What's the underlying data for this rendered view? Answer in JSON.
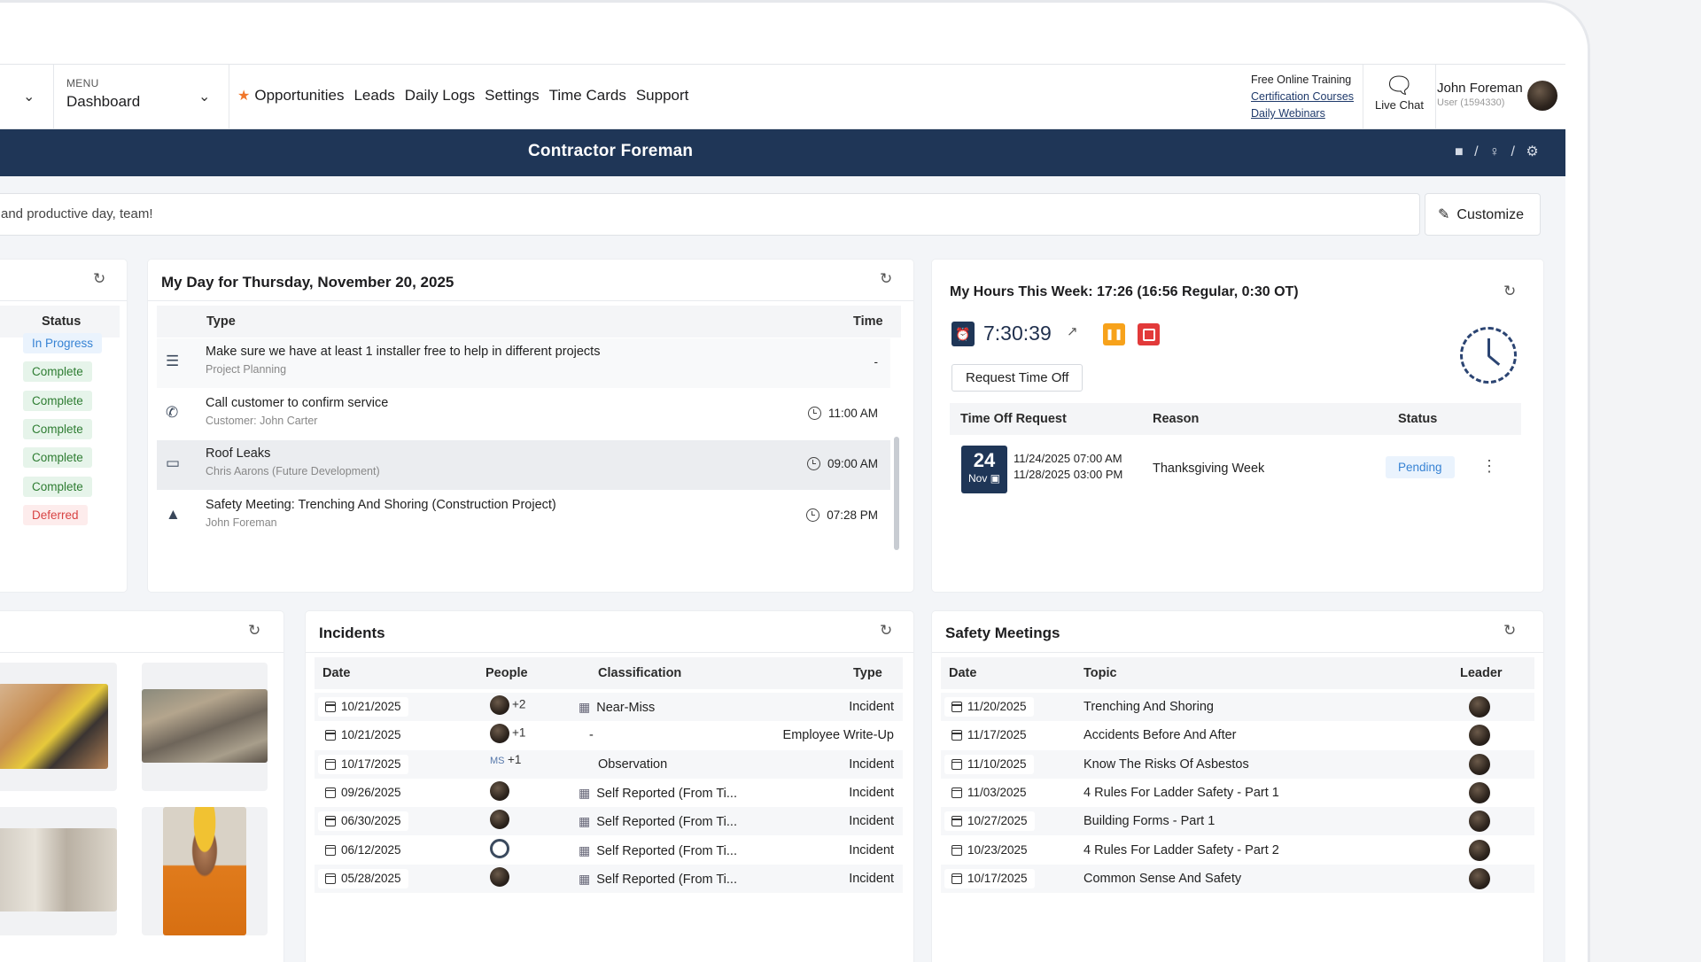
{
  "nav": {
    "menu_caption": "MENU",
    "menu_value": "Dashboard",
    "links": [
      "Opportunities",
      "Leads",
      "Daily Logs",
      "Settings",
      "Time Cards",
      "Support"
    ],
    "training_title": "Free Online Training",
    "training_links": [
      "Certification Courses",
      "Daily Webinars"
    ],
    "live_chat": "Live Chat",
    "user_name": "John Foreman",
    "user_sub": "User (1594330)"
  },
  "banner": {
    "title": "Contractor Foreman",
    "tools": "■ / ♀ / ⚙"
  },
  "message": "and productive day, team!",
  "customize": "Customize",
  "status_card": {
    "header": "Status",
    "items": [
      {
        "label": "In Progress",
        "kind": "blue"
      },
      {
        "label": "Complete",
        "kind": "green"
      },
      {
        "label": "Complete",
        "kind": "green"
      },
      {
        "label": "Complete",
        "kind": "green"
      },
      {
        "label": "Complete",
        "kind": "green"
      },
      {
        "label": "Complete",
        "kind": "green"
      },
      {
        "label": "Deferred",
        "kind": "red"
      }
    ]
  },
  "my_day": {
    "title": "My Day for Thursday, November 20, 2025",
    "col_type": "Type",
    "col_time": "Time",
    "rows": [
      {
        "icon": "list-icon",
        "glyph": "☰",
        "title": "Make sure we have at least 1 installer free to help in different projects",
        "sub": "Project Planning",
        "time": "-",
        "clock": false
      },
      {
        "icon": "phone-icon",
        "glyph": "✆",
        "title": "Call customer to confirm service",
        "sub": "Customer: John Carter",
        "time": "11:00 AM",
        "clock": true
      },
      {
        "icon": "ticket-icon",
        "glyph": "▭",
        "title": "Roof Leaks",
        "sub": "Chris Aarons (Future Development)",
        "time": "09:00 AM",
        "clock": true
      },
      {
        "icon": "person-icon",
        "glyph": "▲",
        "title": "Safety Meeting: Trenching And Shoring (Construction Project)",
        "sub": "John Foreman",
        "time": "07:28 PM",
        "clock": true
      }
    ]
  },
  "hours": {
    "title": "My Hours This Week: 17:26 (16:56 Regular, 0:30 OT)",
    "timer": "7:30:39",
    "request_btn": "Request Time Off",
    "col_request": "Time Off Request",
    "col_reason": "Reason",
    "col_status": "Status",
    "request": {
      "day": "24",
      "month": "Nov",
      "start": "11/24/2025 07:00 AM",
      "end": "11/28/2025 03:00 PM",
      "reason": "Thanksgiving Week",
      "status": "Pending"
    }
  },
  "incidents": {
    "title": "Incidents",
    "cols": [
      "Date",
      "People",
      "Classification",
      "Type"
    ],
    "rows": [
      {
        "date": "10/21/2025",
        "people": "+2",
        "people_kind": "avatar",
        "classification": "Near-Miss",
        "class_icon": true,
        "type": "Incident"
      },
      {
        "date": "10/21/2025",
        "people": "+1",
        "people_kind": "avatar",
        "classification": "-",
        "class_icon": false,
        "type": "Employee Write-Up"
      },
      {
        "date": "10/17/2025",
        "people": "+1",
        "people_kind": "ms",
        "classification": "Observation",
        "class_icon": false,
        "type": "Incident"
      },
      {
        "date": "09/26/2025",
        "people": "",
        "people_kind": "avatar",
        "classification": "Self Reported (From Ti...",
        "class_icon": true,
        "type": "Incident"
      },
      {
        "date": "06/30/2025",
        "people": "",
        "people_kind": "avatar",
        "classification": "Self Reported (From Ti...",
        "class_icon": true,
        "type": "Incident"
      },
      {
        "date": "06/12/2025",
        "people": "",
        "people_kind": "ghost",
        "classification": "Self Reported (From Ti...",
        "class_icon": true,
        "type": "Incident"
      },
      {
        "date": "05/28/2025",
        "people": "",
        "people_kind": "avatar",
        "classification": "Self Reported (From Ti...",
        "class_icon": true,
        "type": "Incident"
      }
    ],
    "ms_initials": "MS"
  },
  "safety": {
    "title": "Safety Meetings",
    "cols": [
      "Date",
      "Topic",
      "Leader"
    ],
    "rows": [
      {
        "date": "11/20/2025",
        "topic": "Trenching And Shoring"
      },
      {
        "date": "11/17/2025",
        "topic": "Accidents Before And After"
      },
      {
        "date": "11/10/2025",
        "topic": "Know The Risks Of Asbestos"
      },
      {
        "date": "11/03/2025",
        "topic": "4 Rules For Ladder Safety - Part 1"
      },
      {
        "date": "10/27/2025",
        "topic": "Building Forms - Part 1"
      },
      {
        "date": "10/23/2025",
        "topic": "4 Rules For Ladder Safety - Part 2"
      },
      {
        "date": "10/17/2025",
        "topic": "Common Sense And Safety"
      }
    ]
  },
  "colors": {
    "brand_navy": "#1f3657",
    "accent_orange": "#f0762a",
    "pause": "#f7a21b",
    "stop": "#e23a3a"
  }
}
